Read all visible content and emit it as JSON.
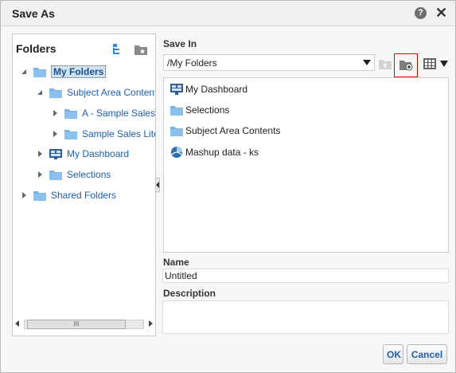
{
  "dialog": {
    "title": "Save As"
  },
  "folders": {
    "heading": "Folders",
    "tree": [
      {
        "label": "My Folders",
        "expanded": true,
        "selected": true,
        "icon": "folder-icon"
      },
      {
        "label": "Subject Area Contents",
        "expanded": true,
        "icon": "folder-icon"
      },
      {
        "label": "A - Sample Sales",
        "icon": "folder-icon"
      },
      {
        "label": "Sample Sales Lite",
        "icon": "folder-icon"
      },
      {
        "label": "My Dashboard",
        "icon": "dashboard-icon"
      },
      {
        "label": "Selections",
        "icon": "folder-icon"
      },
      {
        "label": "Shared Folders",
        "icon": "folder-icon"
      }
    ],
    "scroll_thumb": "III"
  },
  "save_in": {
    "label": "Save In",
    "value": "/My Folders"
  },
  "contents": [
    {
      "label": "My Dashboard",
      "icon": "dashboard-icon"
    },
    {
      "label": "Selections",
      "icon": "folder-icon"
    },
    {
      "label": "Subject Area Contents",
      "icon": "folder-icon"
    },
    {
      "label": "Mashup data - ks",
      "icon": "mashup-icon"
    }
  ],
  "name": {
    "label": "Name",
    "value": "Untitled"
  },
  "description": {
    "label": "Description",
    "value": ""
  },
  "buttons": {
    "ok": "OK",
    "cancel": "Cancel"
  },
  "colors": {
    "link": "#1f5fa8",
    "folder": "#7ab3e6",
    "highlight": "#cfe3f7",
    "new_folder_outline": "#ee0000"
  }
}
